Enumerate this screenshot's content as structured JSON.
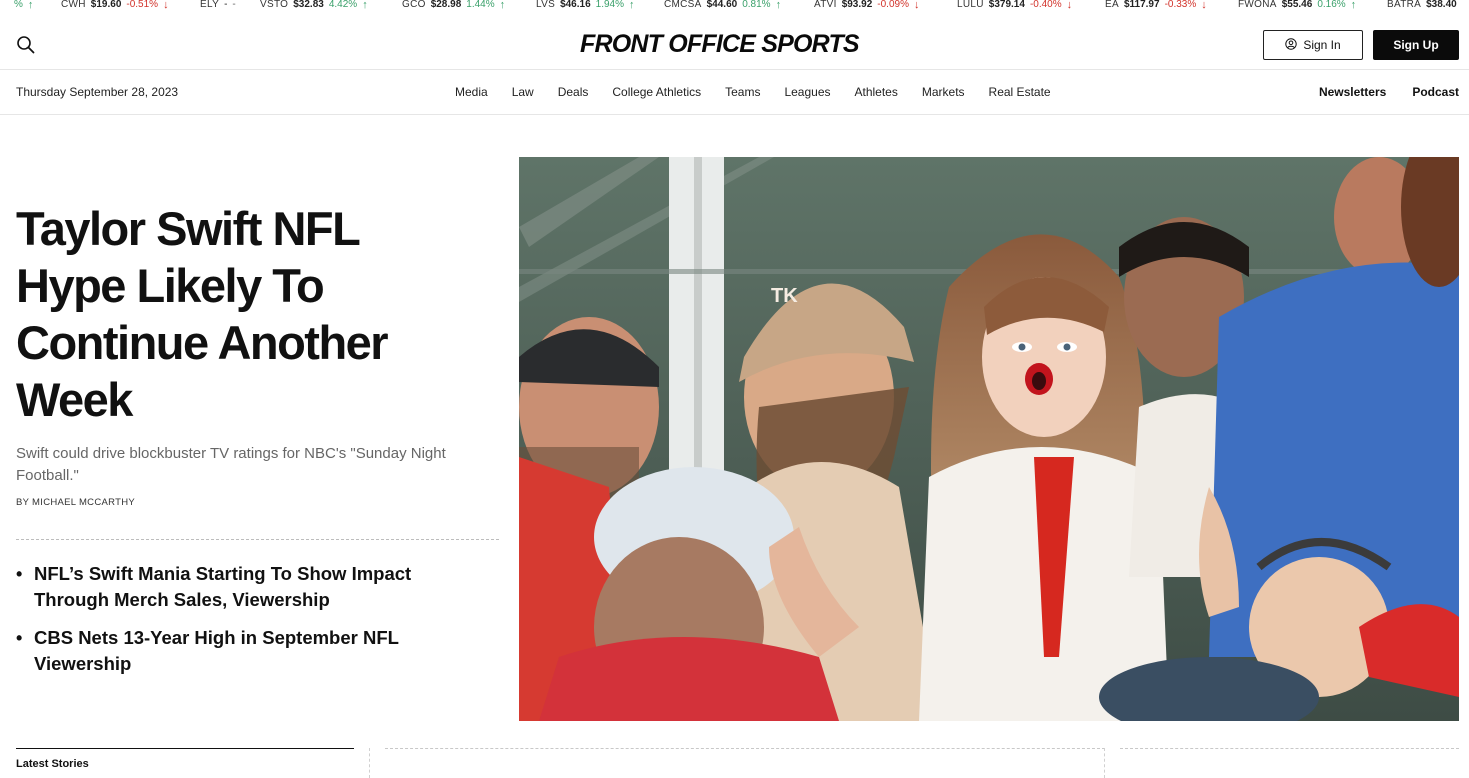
{
  "ticker": [
    {
      "symbol": "",
      "price": "",
      "change": "%",
      "dir": "up"
    },
    {
      "symbol": "CWH",
      "price": "$19.60",
      "change": "-0.51%",
      "dir": "down"
    },
    {
      "symbol": "ELY",
      "price": "-",
      "change": "-",
      "dir": "none"
    },
    {
      "symbol": "VSTO",
      "price": "$32.83",
      "change": "4.42%",
      "dir": "up"
    },
    {
      "symbol": "GCO",
      "price": "$28.98",
      "change": "1.44%",
      "dir": "up"
    },
    {
      "symbol": "LVS",
      "price": "$46.16",
      "change": "1.94%",
      "dir": "up"
    },
    {
      "symbol": "CMCSA",
      "price": "$44.60",
      "change": "0.81%",
      "dir": "up"
    },
    {
      "symbol": "ATVI",
      "price": "$93.92",
      "change": "-0.09%",
      "dir": "down"
    },
    {
      "symbol": "LULU",
      "price": "$379.14",
      "change": "-0.40%",
      "dir": "down"
    },
    {
      "symbol": "EA",
      "price": "$117.97",
      "change": "-0.33%",
      "dir": "down"
    },
    {
      "symbol": "FWONA",
      "price": "$55.46",
      "change": "0.16%",
      "dir": "up"
    },
    {
      "symbol": "BATRA",
      "price": "$38.40",
      "change": "",
      "dir": "none"
    }
  ],
  "header": {
    "logo": "FRONT OFFICE SPORTS",
    "sign_in": "Sign In",
    "sign_up": "Sign Up"
  },
  "navbar": {
    "date": "Thursday September 28, 2023",
    "links": [
      "Media",
      "Law",
      "Deals",
      "College Athletics",
      "Teams",
      "Leagues",
      "Athletes",
      "Markets",
      "Real Estate"
    ],
    "right": [
      "Newsletters",
      "Podcast"
    ]
  },
  "hero": {
    "headline": "Taylor Swift NFL Hype Likely To Continue Another Week",
    "dek": "Swift could drive blockbuster TV ratings for NBC's \"Sunday Night Football.\"",
    "byline": "BY MICHAEL MCCARTHY",
    "related": [
      "NFL’s Swift Mania Starting To Show Impact Through Merch Sales, Viewership",
      "CBS Nets 13-Year High in September NFL Viewership"
    ],
    "cap_text": "TK"
  },
  "latest": {
    "label": "Latest Stories"
  },
  "colors": {
    "up": "#3aa06a",
    "down": "#d2332b",
    "accent": "#0b0b0b"
  }
}
